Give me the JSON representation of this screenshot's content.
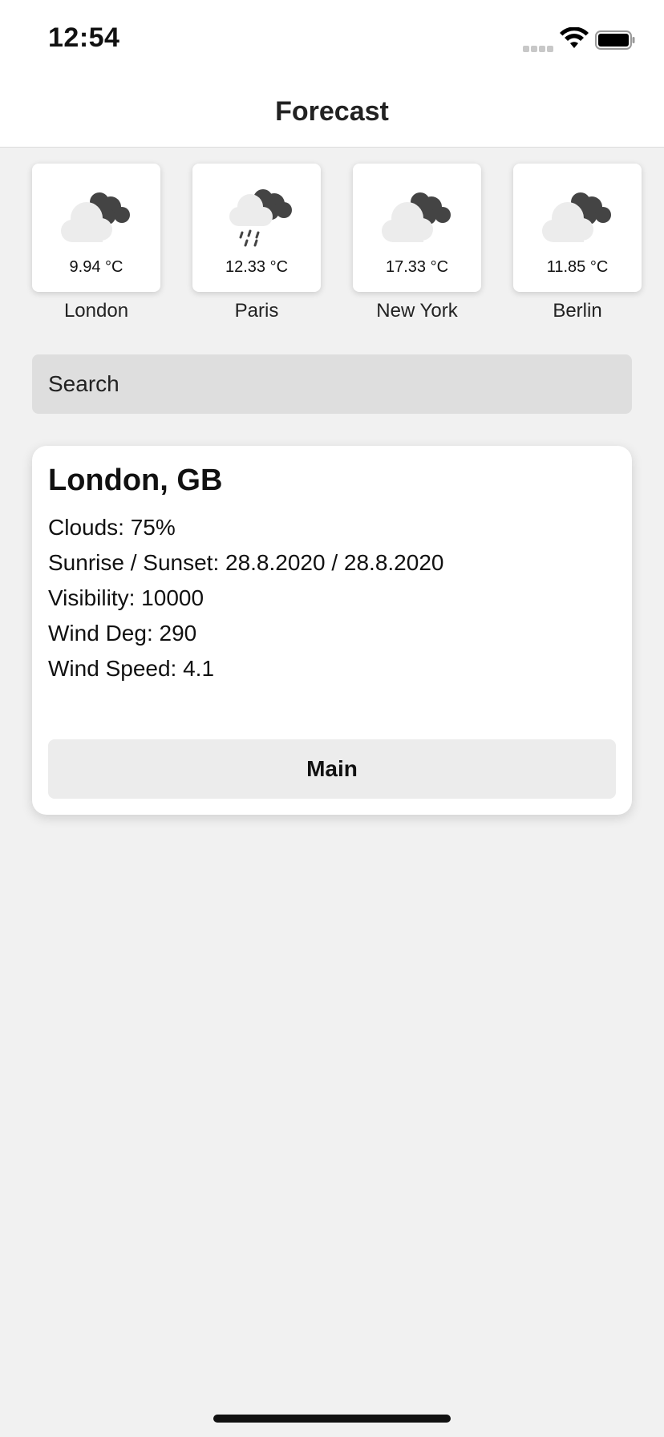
{
  "status_bar": {
    "time": "12:54"
  },
  "nav": {
    "title": "Forecast"
  },
  "cities": [
    {
      "name": "London",
      "temp": "9.94 °C",
      "icon": "cloudy-icon"
    },
    {
      "name": "Paris",
      "temp": "12.33 °C",
      "icon": "rain-icon"
    },
    {
      "name": "New York",
      "temp": "17.33 °C",
      "icon": "cloudy-icon"
    },
    {
      "name": "Berlin",
      "temp": "11.85 °C",
      "icon": "cloudy-icon"
    }
  ],
  "search": {
    "placeholder": "Search"
  },
  "detail": {
    "title": "London, GB",
    "clouds": "Clouds: 75%",
    "sun": "Sunrise / Sunset: 28.8.2020 / 28.8.2020",
    "visibility": "Visibility: 10000",
    "wind_deg": "Wind Deg: 290",
    "wind_speed": "Wind Speed: 4.1",
    "button_label": "Main"
  },
  "colors": {
    "background": "#f1f1f1",
    "card": "#ffffff",
    "search_bg": "#dedede",
    "button_bg": "#ececec"
  }
}
